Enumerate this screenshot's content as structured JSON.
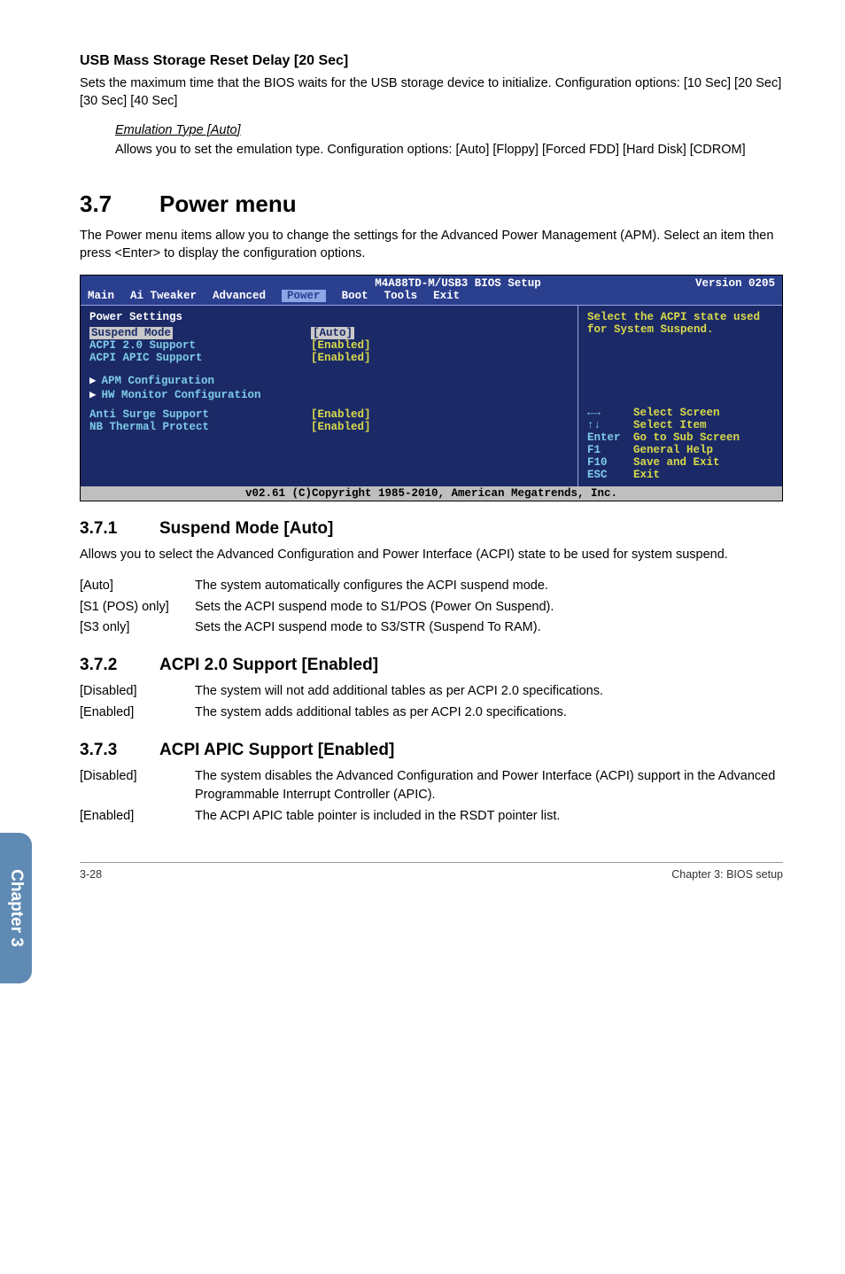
{
  "h1": "USB Mass Storage Reset Delay [20 Sec]",
  "p1": "Sets the maximum time that the BIOS waits for the USB storage device to initialize. Configuration options: [10 Sec] [20 Sec] [30 Sec] [40 Sec]",
  "emul_title": "Emulation Type [Auto]",
  "emul_body": "Allows you to set the emulation type. Configuration options: [Auto] [Floppy] [Forced FDD] [Hard Disk] [CDROM]",
  "sec_num": "3.7",
  "sec_title": "Power menu",
  "sec_body": "The Power menu items allow you to change the settings for the Advanced Power Management (APM). Select an item then press <Enter> to display the configuration options.",
  "bios": {
    "title": "M4A88TD-M/USB3 BIOS Setup",
    "version": "Version 0205",
    "tabs": [
      "Main",
      "Ai Tweaker",
      "Advanced",
      "Power",
      "Boot",
      "Tools",
      "Exit"
    ],
    "selected_tab": "Power",
    "hdr": "Power Settings",
    "rows": [
      {
        "f": "Suspend Mode",
        "v": "[Auto]",
        "hl": true
      },
      {
        "f": "ACPI 2.0 Support",
        "v": "[Enabled]"
      },
      {
        "f": "ACPI APIC Support",
        "v": "[Enabled]"
      }
    ],
    "sec_items": [
      "APM Configuration",
      "HW Monitor Configuration"
    ],
    "rows2": [
      {
        "f": "Anti Surge Support",
        "v": "[Enabled]"
      },
      {
        "f": "NB Thermal Protect",
        "v": "[Enabled]"
      }
    ],
    "help": "Select the ACPI state used for System Suspend.",
    "nav": [
      {
        "k": "←→",
        "t": "Select Screen"
      },
      {
        "k": "↑↓",
        "t": "Select Item"
      },
      {
        "k": "Enter",
        "t": "Go to Sub Screen"
      },
      {
        "k": "F1",
        "t": "General Help"
      },
      {
        "k": "F10",
        "t": "Save and Exit"
      },
      {
        "k": "ESC",
        "t": "Exit"
      }
    ],
    "foot": "v02.61 (C)Copyright 1985-2010, American Megatrends, Inc."
  },
  "s371": {
    "num": "3.7.1",
    "title": "Suspend Mode [Auto]"
  },
  "s371_body": "Allows you to select the Advanced Configuration and Power Interface (ACPI) state to be used for system suspend.",
  "s371_defs": [
    {
      "l": "[Auto]",
      "t": "The system automatically configures the ACPI suspend mode."
    },
    {
      "l": "[S1 (POS) only]",
      "t": "Sets the ACPI suspend mode to S1/POS (Power On Suspend)."
    },
    {
      "l": "[S3 only]",
      "t": "Sets the ACPI suspend mode to S3/STR (Suspend To RAM)."
    }
  ],
  "s372": {
    "num": "3.7.2",
    "title": "ACPI 2.0 Support [Enabled]"
  },
  "s372_defs": [
    {
      "l": "[Disabled]",
      "t": "The system will not add additional tables as per ACPI 2.0 specifications."
    },
    {
      "l": "[Enabled]",
      "t": "The system adds additional tables as per ACPI 2.0 specifications."
    }
  ],
  "s373": {
    "num": "3.7.3",
    "title": "ACPI APIC Support [Enabled]"
  },
  "s373_defs": [
    {
      "l": "[Disabled]",
      "t": "The system disables the Advanced Configuration and Power Interface (ACPI) support in the Advanced Programmable Interrupt Controller (APIC)."
    },
    {
      "l": "[Enabled]",
      "t": "The ACPI APIC table pointer is included in the RSDT pointer list."
    }
  ],
  "side": "Chapter 3",
  "footer_left": "3-28",
  "footer_right": "Chapter 3: BIOS setup"
}
